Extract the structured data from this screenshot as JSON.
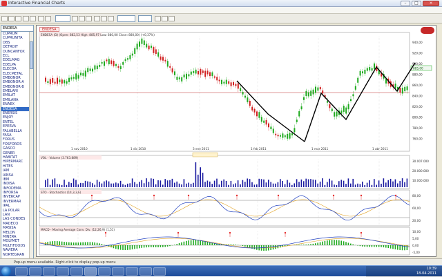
{
  "window": {
    "title": "Interactive Financial Charts",
    "controls": {
      "minimize": "–",
      "maximize": "□",
      "close": "×"
    }
  },
  "menubar": {
    "items": [
      "",
      "",
      "",
      "",
      "",
      "",
      ""
    ]
  },
  "toolbar": {
    "period_combo": "",
    "date_combo": "",
    "zoom_combo": ""
  },
  "sidebar": {
    "search_value": "ENDESA",
    "symbols": [
      "CUPRUM",
      "CUPRUNITA",
      "DBS",
      "DETROIT",
      "DUNCANFOX",
      "ECL",
      "EDELMAG",
      "EDELPA",
      "ELECDA",
      "ELECMETAL",
      "EMBONOR",
      "EMBONOR-A",
      "EMBONOR-B",
      "EMELARI",
      "EMILAT",
      "EMILANA",
      "ENAEX",
      "ENDESA",
      "ENERSIS",
      "ENJOY",
      "ENTEL",
      "EPERVA",
      "FALABELLA",
      "FASA",
      "FORUS",
      "FOSFOROS",
      "GASCO",
      "GENER",
      "HABITAT",
      "HIPERMARC",
      "HITES",
      "IAM",
      "IANSA",
      "IBM",
      "INDISA",
      "INFODEMA",
      "INFORSA",
      "INVERCAP",
      "INVERMAR",
      "IPAL",
      "LA POLAR",
      "LAN",
      "LAS CONDES",
      "MADECO",
      "MASISA",
      "MELON",
      "MINERA",
      "MOLYMET",
      "MULTIFOODS",
      "NAVIERA",
      "NORTEGRAN"
    ],
    "selected_index": 17
  },
  "chart": {
    "symbol_tab": "ENDESA",
    "price_header": "ENDESA (D) (Open: 882,53  High: 885,97  Low: 880,00  Close: 880,00) (+0,37%)",
    "volume_header": "VOL - Volume (3.763.889)",
    "stoch_header": "STO - Stochastics (14,3,3,E)",
    "macd_header": "MACD - Moving Average Conv. Div. (12,26,9) (1,51)",
    "date_labels": [
      "1 nov 2010",
      "1 dic 2010",
      "3 ene 2011",
      "1 feb 2011",
      "1 mar 2011",
      "1 abr 2011"
    ],
    "price_axis": [
      "940,00",
      "920,00",
      "900,00",
      "880,00",
      "860,00",
      "840,00",
      "820,00",
      "800,00",
      "780,00",
      "760,00"
    ],
    "last_price_tag": "885,00",
    "volume_axis": [
      "30.007.000",
      "20.000.000",
      "10.000.000"
    ],
    "stoch_axis": [
      "80,00",
      "60,00",
      "20,00"
    ],
    "macd_axis": [
      "10,00",
      "5,00",
      "0,00",
      "-5,00"
    ],
    "colors": {
      "up": "#1faa1f",
      "down": "#d01f1f",
      "volume": "#1a1aa0",
      "trendline": "#000000",
      "stoch_k": "#1f3fbf",
      "stoch_d": "#e0a020",
      "macd_line": "#1f3fbf",
      "signal_line": "#e0a020",
      "histogram": "#1faa1f",
      "signal_marker": "#e53030"
    }
  },
  "statusbar": {
    "text": "Pop-up menu available. Right-click to display pop-up menu"
  },
  "taskbar": {
    "time": "10:39",
    "date": "18-04-2011"
  }
}
